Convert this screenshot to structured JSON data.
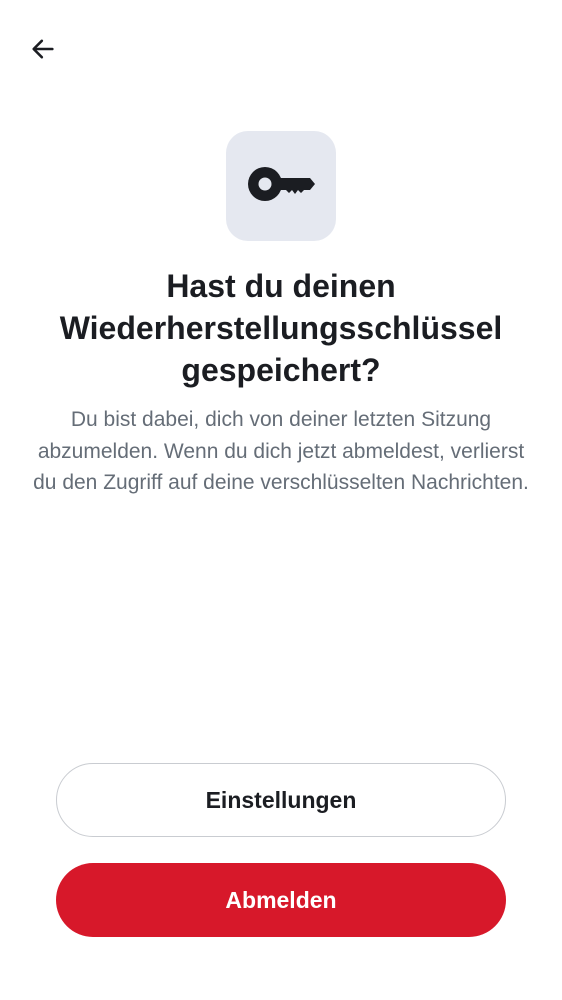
{
  "header": {
    "back_icon": "arrow-left-icon"
  },
  "hero": {
    "icon": "key-icon",
    "tile_color": "#e5e8f0"
  },
  "title": "Hast du deinen Wiederherstellungsschlüssel gespeichert?",
  "description": "Du bist dabei, dich von deiner letzten Sitzung abzumelden. Wenn du dich jetzt abmeldest, verlierst du den Zugriff auf deine verschlüsselten Nachrichten.",
  "actions": {
    "settings_label": "Einstellungen",
    "logout_label": "Abmelden"
  },
  "colors": {
    "primary": "#d7182a",
    "text": "#1b1d22",
    "secondary_text": "#656d77"
  }
}
